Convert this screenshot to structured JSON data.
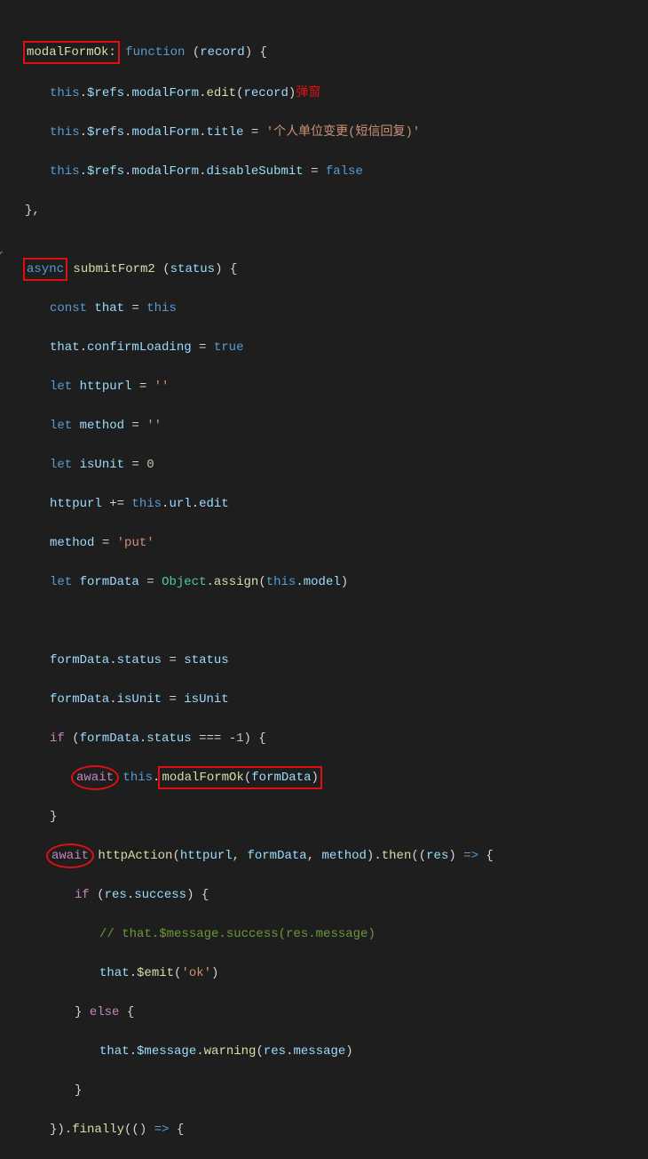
{
  "lines": {
    "l1_a": "modalFormOk:",
    "l1_b": " function",
    "l1_c": " (",
    "l1_d": "record",
    "l1_e": ") {",
    "l2_a": "this",
    "l2_b": ".",
    "l2_c": "$refs",
    "l2_d": ".",
    "l2_e": "modalForm",
    "l2_f": ".",
    "l2_g": "edit",
    "l2_h": "(",
    "l2_i": "record",
    "l2_j": ")",
    "l2_annot": "弹窗",
    "l3_a": "this",
    "l3_b": ".",
    "l3_c": "$refs",
    "l3_d": ".",
    "l3_e": "modalForm",
    "l3_f": ".",
    "l3_g": "title",
    "l3_h": " = ",
    "l3_i": "'个人单位变更(短信回复)'",
    "l4_a": "this",
    "l4_b": ".",
    "l4_c": "$refs",
    "l4_d": ".",
    "l4_e": "modalForm",
    "l4_f": ".",
    "l4_g": "disableSubmit",
    "l4_h": " = ",
    "l4_i": "false",
    "l5": "},",
    "l7_a": "async",
    "l7_b": " submitForm2",
    "l7_c": " (",
    "l7_d": "status",
    "l7_e": ") {",
    "l8_a": "const",
    "l8_b": " that",
    "l8_c": " = ",
    "l8_d": "this",
    "l9_a": "that",
    "l9_b": ".",
    "l9_c": "confirmLoading",
    "l9_d": " = ",
    "l9_e": "true",
    "l10_a": "let",
    "l10_b": " httpurl",
    "l10_c": " = ",
    "l10_d": "''",
    "l11_a": "let",
    "l11_b": " method",
    "l11_c": " = ",
    "l11_d": "''",
    "l12_a": "let",
    "l12_b": " isUnit",
    "l12_c": " = ",
    "l12_d": "0",
    "l13_a": "httpurl",
    "l13_b": " += ",
    "l13_c": "this",
    "l13_d": ".",
    "l13_e": "url",
    "l13_f": ".",
    "l13_g": "edit",
    "l14_a": "method",
    "l14_b": " = ",
    "l14_c": "'put'",
    "l15_a": "let",
    "l15_b": " formData",
    "l15_c": " = ",
    "l15_d": "Object",
    "l15_e": ".",
    "l15_f": "assign",
    "l15_g": "(",
    "l15_h": "this",
    "l15_i": ".",
    "l15_j": "model",
    "l15_k": ")",
    "l17_a": "formData",
    "l17_b": ".",
    "l17_c": "status",
    "l17_d": " = ",
    "l17_e": "status",
    "l18_a": "formData",
    "l18_b": ".",
    "l18_c": "isUnit",
    "l18_d": " = ",
    "l18_e": "isUnit",
    "l19_a": "if",
    "l19_b": " (",
    "l19_c": "formData",
    "l19_d": ".",
    "l19_e": "status",
    "l19_f": " === ",
    "l19_g": "-",
    "l19_h": "1",
    "l19_i": ") {",
    "l20_a": "await",
    "l20_b": " this",
    "l20_c": ".",
    "l20_d": "modalFormOk",
    "l20_e": "(",
    "l20_f": "formData",
    "l20_g": ")",
    "l21": "}",
    "l22_a": "await",
    "l22_b": " httpAction",
    "l22_c": "(",
    "l22_d": "httpurl",
    "l22_e": ", ",
    "l22_f": "formData",
    "l22_g": ", ",
    "l22_h": "method",
    "l22_i": ").",
    "l22_j": "then",
    "l22_k": "((",
    "l22_l": "res",
    "l22_m": ") ",
    "l22_n": "=>",
    "l22_o": " {",
    "l23_a": "if",
    "l23_b": " (",
    "l23_c": "res",
    "l23_d": ".",
    "l23_e": "success",
    "l23_f": ") {",
    "l24": "// that.$message.success(res.message)",
    "l25_a": "that",
    "l25_b": ".",
    "l25_c": "$emit",
    "l25_d": "(",
    "l25_e": "'ok'",
    "l25_f": ")",
    "l26_a": "} ",
    "l26_b": "else",
    "l26_c": " {",
    "l27_a": "that",
    "l27_b": ".",
    "l27_c": "$message",
    "l27_d": ".",
    "l27_e": "warning",
    "l27_f": "(",
    "l27_g": "res",
    "l27_h": ".",
    "l27_i": "message",
    "l27_j": ")",
    "l28": "}",
    "l29_a": "}).",
    "l29_b": "finally",
    "l29_c": "(() ",
    "l29_d": "=>",
    "l29_e": " {"
  },
  "gutter": {
    "chevron": "⌄"
  }
}
